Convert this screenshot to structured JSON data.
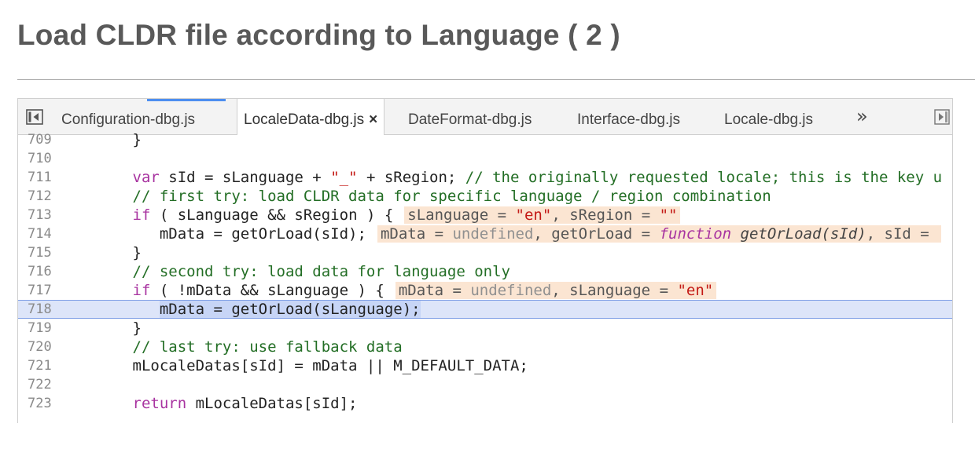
{
  "slide": {
    "title": "Load CLDR file according to Language ( 2 )"
  },
  "editor": {
    "tabs": [
      {
        "label": "Configuration-dbg.js",
        "active": false
      },
      {
        "label": "LocaleData-dbg.js",
        "active": true,
        "close_glyph": "×"
      },
      {
        "label": "DateFormat-dbg.js",
        "active": false
      },
      {
        "label": "Interface-dbg.js",
        "active": false
      },
      {
        "label": "Locale-dbg.js",
        "active": false
      }
    ],
    "overflow_glyph": "»",
    "icons": {
      "left": "toggle-navigator-icon",
      "right": "toggle-debugger-icon"
    },
    "lines": {
      "l709": {
        "num": "709",
        "code": "        }"
      },
      "l710": {
        "num": "710",
        "code": ""
      },
      "l711": {
        "num": "711",
        "kw": "var",
        "pre": "        ",
        "a": " sId = sLanguage + ",
        "str": "\"_\"",
        "b": " + sRegion; ",
        "comment": "// the originally requested locale; this is the key u"
      },
      "l712": {
        "num": "712",
        "comment": "        // first try: load CLDR data for specific language / region combination"
      },
      "l713": {
        "num": "713",
        "kw": "if",
        "pre": "        ",
        "a": " ( sLanguage && sRegion ) {",
        "iv1": "sLanguage = ",
        "iv1s": "\"en\"",
        "iv2": ", sRegion = ",
        "iv2s": "\"\""
      },
      "l714": {
        "num": "714",
        "code": "           mData = getOrLoad(sId);",
        "iv1": "mData = ",
        "iv1u": "undefined",
        "iv2": ", getOrLoad = ",
        "ivkw": "function",
        "ivfn": " getOrLoad(sId)",
        "iv3": ", sId = "
      },
      "l715": {
        "num": "715",
        "code": "        }"
      },
      "l716": {
        "num": "716",
        "comment": "        // second try: load data for language only"
      },
      "l717": {
        "num": "717",
        "kw": "if",
        "pre": "        ",
        "a": " ( !mData && sLanguage ) {",
        "iv1": "mData = ",
        "iv1u": "undefined",
        "iv2": ", sLanguage = ",
        "iv2s": "\"en\""
      },
      "l718": {
        "num": "718",
        "pre": "           ",
        "code": "mData = getOrLoad(sLanguage);"
      },
      "l719": {
        "num": "719",
        "code": "        }"
      },
      "l720": {
        "num": "720",
        "comment": "        // last try: use fallback data"
      },
      "l721": {
        "num": "721",
        "code": "        mLocaleDatas[sId] = mData || M_DEFAULT_DATA;"
      },
      "l722": {
        "num": "722",
        "code": ""
      },
      "l723": {
        "num": "723",
        "kw": "return",
        "pre": "        ",
        "a": " mLocaleDatas[sId];"
      }
    }
  }
}
